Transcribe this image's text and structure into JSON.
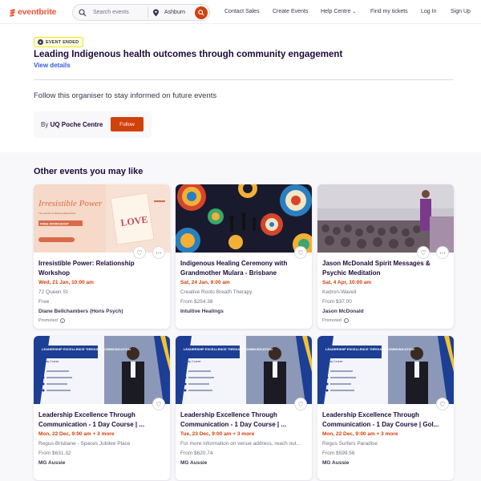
{
  "nav": {
    "logo_text": "eventbrite",
    "search_placeholder": "Search events",
    "location": "Ashburn",
    "links": [
      "Contact Sales",
      "Create Events",
      "Help Centre",
      "Find my tickets",
      "Log In",
      "Sign Up"
    ]
  },
  "event": {
    "badge": "EVENT ENDED",
    "title": "Leading Indigenous health outcomes through community engagement",
    "view_details": "View details",
    "follow_prompt": "Follow this organiser to stay informed on future events",
    "by_label": "By",
    "organiser": "UQ Poche Centre",
    "follow_label": "Follow"
  },
  "other": {
    "heading": "Other events you may like",
    "cards": [
      {
        "title_line1": "Irresistible Power: Relationship",
        "title_line2": "Workshop",
        "date": "Wed, 21 Jan, 10:00 am",
        "location": "72 Queen St",
        "price": "Free",
        "organiser": "Diane Bellchambers (Hons Psych)",
        "promoted": "Promoted",
        "image_text": "Irresistible Power",
        "image_sub": "The secrets of lasting relationships",
        "image_tag": "FREE WORKSHOP",
        "image_card": "LOVE"
      },
      {
        "title_line1": "Indigenous Healing Ceremony with",
        "title_line2": "Grandmother Mulara - Brisbane",
        "date": "Sat, 24 Jan, 9:00 am",
        "location": "Creative Roots Breath Therapy",
        "price": "From $254.38",
        "organiser": "Intuitive Healings"
      },
      {
        "title_line1": "Jason McDonald Spirit Messages &",
        "title_line2": "Psychic Meditation",
        "date": "Sat, 4 Apr, 10:00 am",
        "location": "Kedron-Wavell",
        "price": "From $37.00",
        "organiser": "Jason McDonald",
        "promoted": "Promoted"
      },
      {
        "title_line1": "Leadership Excellence Through",
        "title_line2": "Communication - 1 Day Course | ...",
        "date": "Mon, 22 Dec, 9:00 am + 3 more",
        "location": "Regus-Brisbane - Spaces Jubilee Place",
        "price": "From $631.32",
        "organiser": "MG Aussie",
        "image_text": "LEADERSHIP EXCELLENCE THROUGH COMMUNICATION",
        "image_sub": "1 Day Course"
      },
      {
        "title_line1": "Leadership Excellence Through",
        "title_line2": "Communication - 1 Day Course | ...",
        "date": "Tue, 23 Dec, 9:00 am + 3 more",
        "location": "For more information on venue address, reach out...",
        "price": "From $620.74",
        "organiser": "MG Aussie",
        "image_text": "LEADERSHIP EXCELLENCE THROUGH COMMUNICATION",
        "image_sub": "1 Day Course"
      },
      {
        "title_line1": "Leadership Excellence Through",
        "title_line2": "Communication - 1 Day Course | Gol...",
        "date": "Mon, 22 Dec, 9:00 am + 3 more",
        "location": "Regus Surfers Paradise",
        "price": "From $599.56",
        "organiser": "MG Aussie",
        "image_text": "LEADERSHIP EXCELLENCE THROUGH COMMUNICATION",
        "image_sub": "1 Day Course"
      }
    ]
  },
  "colors": {
    "brand": "#f05537",
    "accent": "#d1410c",
    "link": "#3659e3"
  }
}
